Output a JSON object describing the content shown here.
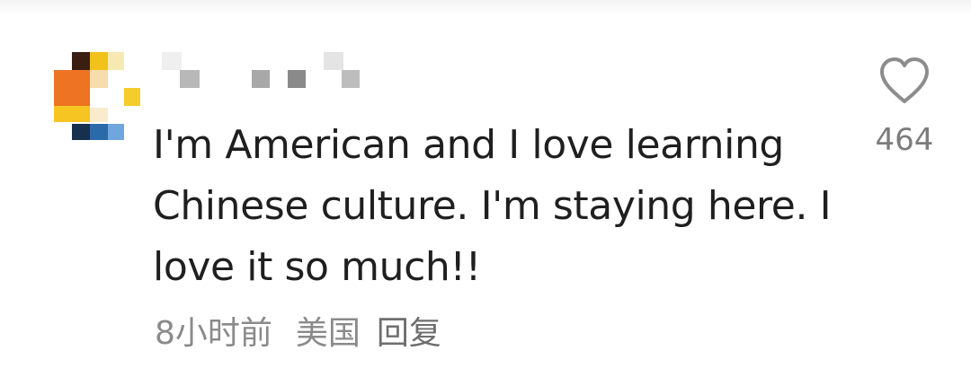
{
  "comment": {
    "text": "I'm American and I love learning Chinese culture. I'm staying here. I love it so much!!",
    "time": "8小时前",
    "location": "美国",
    "reply_label": "回复",
    "likes": "464"
  },
  "icons": {
    "like": "heart-outline-icon"
  },
  "colors": {
    "text": "#1f1f1f",
    "meta": "#8a8a8a",
    "icon": "#8c8c8c"
  }
}
